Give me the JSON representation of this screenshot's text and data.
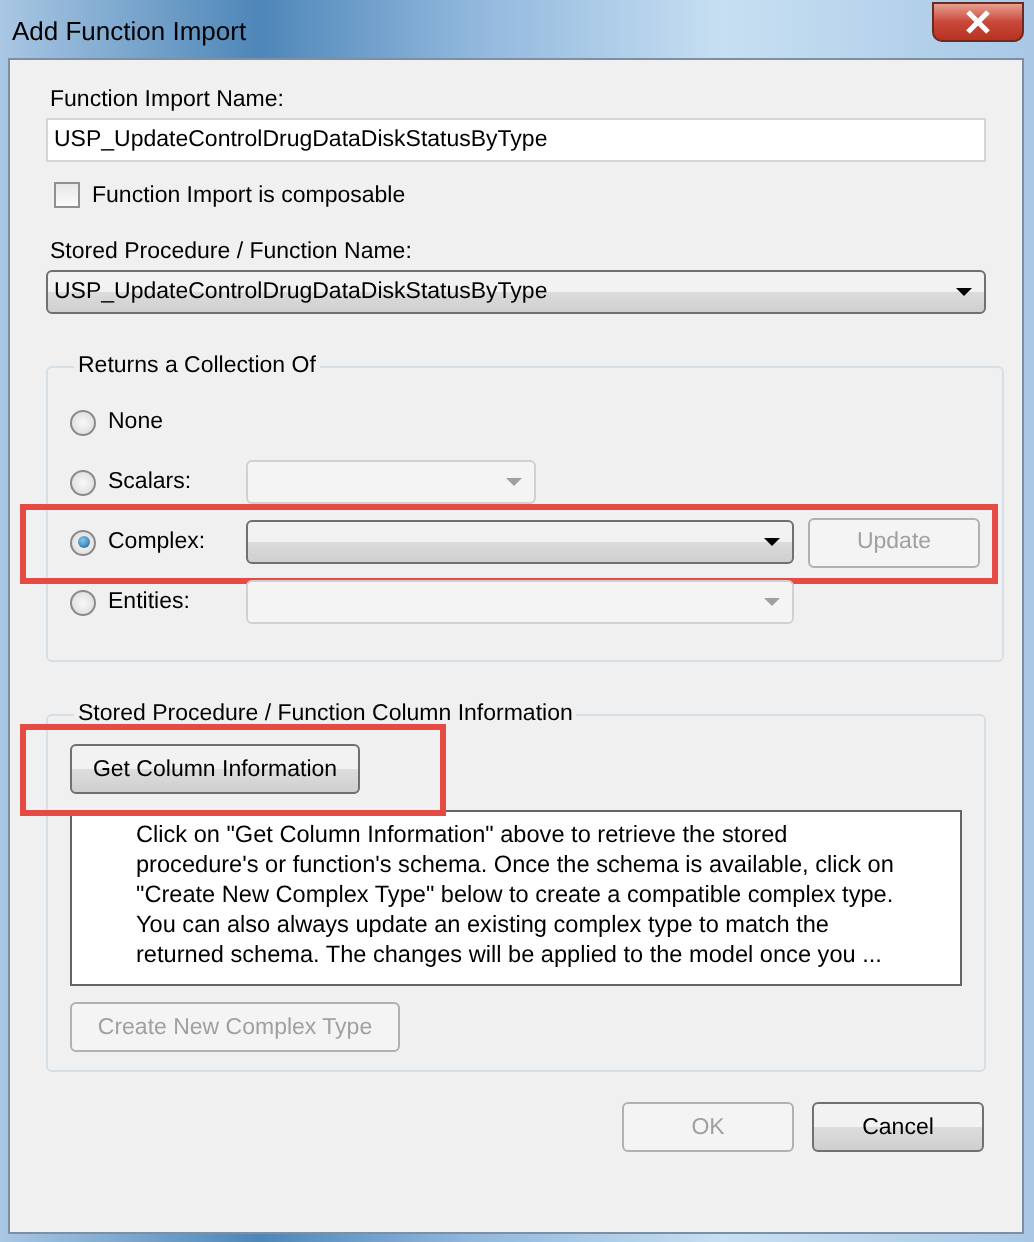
{
  "window": {
    "title": "Add Function Import"
  },
  "function_import_name": {
    "label": "Function Import Name:",
    "value": "USP_UpdateControlDrugDataDiskStatusByType"
  },
  "composable": {
    "label": "Function Import is composable",
    "checked": false
  },
  "stored_procedure": {
    "label": "Stored Procedure / Function Name:",
    "value": "USP_UpdateControlDrugDataDiskStatusByType"
  },
  "returns": {
    "title": "Returns a Collection Of",
    "options": [
      {
        "label": "None",
        "selected": false,
        "kind": "plain",
        "highlighted": false
      },
      {
        "label": "Scalars:",
        "selected": false,
        "kind": "short_combo",
        "combo_disabled": true,
        "highlighted": false
      },
      {
        "label": "Complex:",
        "selected": true,
        "kind": "combo_button",
        "combo_disabled": false,
        "button": {
          "label": "Update",
          "disabled": true
        },
        "highlighted": true
      },
      {
        "label": "Entities:",
        "selected": false,
        "kind": "combo",
        "combo_disabled": true,
        "highlighted": false
      }
    ]
  },
  "column_info": {
    "title": "Stored Procedure / Function Column Information",
    "button": {
      "label": "Get Column Information",
      "disabled": false,
      "highlighted": true
    },
    "description": "Click on \"Get Column Information\" above to retrieve the stored procedure's or function's schema. Once the schema is available, click on \"Create New Complex Type\" below to create a compatible complex type. You can also always update an existing complex type to match the returned schema. The changes will be applied to the model once you ...",
    "create_button": {
      "label": "Create New Complex Type",
      "disabled": true
    }
  },
  "buttons": [
    {
      "label": "OK",
      "disabled": true
    },
    {
      "label": "Cancel",
      "disabled": false
    }
  ]
}
